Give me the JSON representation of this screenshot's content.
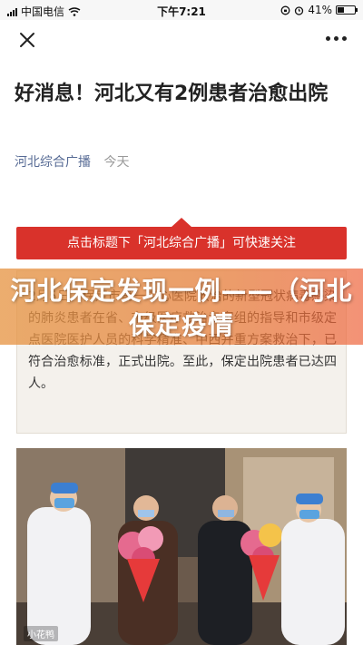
{
  "status_bar": {
    "carrier": "中国电信",
    "time": "下午7:21",
    "battery_percent": "41%",
    "battery_level": 0.41
  },
  "nav": {
    "close_icon": "close-icon",
    "more_icon": "more-icon"
  },
  "article": {
    "title": "好消息！河北又有2例患者治愈出院",
    "author": "河北综合广播",
    "date": "今天",
    "follow_banner": "点击标题下「河北综合广播」可快速关注",
    "body_text": "2月5日，保定市第一中心医院收治的新型冠状病毒感染的肺炎患者在省、市级医疗救治专家组的指导和市级定点医院医护人员的科学精准、中西并重方案救治下，已符合治愈标准，正式出院。至此，保定出院患者已达四人。"
  },
  "overlay": {
    "headline": "河北保定发现一例——（河北保定疫情"
  },
  "watermark": "小花鸭"
}
